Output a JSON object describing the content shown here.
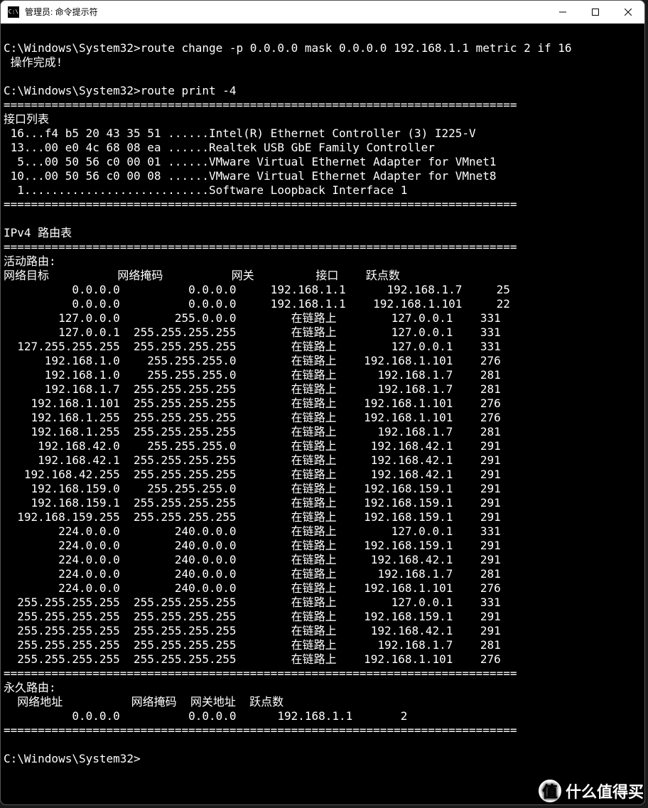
{
  "window": {
    "title": "管理员: 命令提示符",
    "icon_text": "C:\\"
  },
  "terminal": {
    "prompt": "C:\\Windows\\System32>",
    "cmd1": "route change -p 0.0.0.0 mask 0.0.0.0 192.168.1.1 metric 2 if 16",
    "cmd1_result": " 操作完成!",
    "cmd2": "route print -4",
    "divider": "===========================================================================",
    "interface_list_header": "接口列表",
    "interfaces": [
      " 16...f4 b5 20 43 35 51 ......Intel(R) Ethernet Controller (3) I225-V",
      " 13...00 e0 4c 68 08 ea ......Realtek USB GbE Family Controller",
      "  5...00 50 56 c0 00 01 ......VMware Virtual Ethernet Adapter for VMnet1",
      " 10...00 50 56 c0 00 08 ......VMware Virtual Ethernet Adapter for VMnet8",
      "  1...........................Software Loopback Interface 1"
    ],
    "ipv4_header": "IPv4 路由表",
    "active_routes_header": "活动路由:",
    "active_columns": [
      "网络目标",
      "网络掩码",
      "网关",
      "接口",
      "跃点数"
    ],
    "active_routes": [
      {
        "dest": "0.0.0.0",
        "mask": "0.0.0.0",
        "gateway": "192.168.1.1",
        "iface": "192.168.1.7",
        "metric": "25"
      },
      {
        "dest": "0.0.0.0",
        "mask": "0.0.0.0",
        "gateway": "192.168.1.1",
        "iface": "192.168.1.101",
        "metric": "22"
      },
      {
        "dest": "127.0.0.0",
        "mask": "255.0.0.0",
        "gateway": "在链路上",
        "iface": "127.0.0.1",
        "metric": "331"
      },
      {
        "dest": "127.0.0.1",
        "mask": "255.255.255.255",
        "gateway": "在链路上",
        "iface": "127.0.0.1",
        "metric": "331"
      },
      {
        "dest": "127.255.255.255",
        "mask": "255.255.255.255",
        "gateway": "在链路上",
        "iface": "127.0.0.1",
        "metric": "331"
      },
      {
        "dest": "192.168.1.0",
        "mask": "255.255.255.0",
        "gateway": "在链路上",
        "iface": "192.168.1.101",
        "metric": "276"
      },
      {
        "dest": "192.168.1.0",
        "mask": "255.255.255.0",
        "gateway": "在链路上",
        "iface": "192.168.1.7",
        "metric": "281"
      },
      {
        "dest": "192.168.1.7",
        "mask": "255.255.255.255",
        "gateway": "在链路上",
        "iface": "192.168.1.7",
        "metric": "281"
      },
      {
        "dest": "192.168.1.101",
        "mask": "255.255.255.255",
        "gateway": "在链路上",
        "iface": "192.168.1.101",
        "metric": "276"
      },
      {
        "dest": "192.168.1.255",
        "mask": "255.255.255.255",
        "gateway": "在链路上",
        "iface": "192.168.1.101",
        "metric": "276"
      },
      {
        "dest": "192.168.1.255",
        "mask": "255.255.255.255",
        "gateway": "在链路上",
        "iface": "192.168.1.7",
        "metric": "281"
      },
      {
        "dest": "192.168.42.0",
        "mask": "255.255.255.0",
        "gateway": "在链路上",
        "iface": "192.168.42.1",
        "metric": "291"
      },
      {
        "dest": "192.168.42.1",
        "mask": "255.255.255.255",
        "gateway": "在链路上",
        "iface": "192.168.42.1",
        "metric": "291"
      },
      {
        "dest": "192.168.42.255",
        "mask": "255.255.255.255",
        "gateway": "在链路上",
        "iface": "192.168.42.1",
        "metric": "291"
      },
      {
        "dest": "192.168.159.0",
        "mask": "255.255.255.0",
        "gateway": "在链路上",
        "iface": "192.168.159.1",
        "metric": "291"
      },
      {
        "dest": "192.168.159.1",
        "mask": "255.255.255.255",
        "gateway": "在链路上",
        "iface": "192.168.159.1",
        "metric": "291"
      },
      {
        "dest": "192.168.159.255",
        "mask": "255.255.255.255",
        "gateway": "在链路上",
        "iface": "192.168.159.1",
        "metric": "291"
      },
      {
        "dest": "224.0.0.0",
        "mask": "240.0.0.0",
        "gateway": "在链路上",
        "iface": "127.0.0.1",
        "metric": "331"
      },
      {
        "dest": "224.0.0.0",
        "mask": "240.0.0.0",
        "gateway": "在链路上",
        "iface": "192.168.159.1",
        "metric": "291"
      },
      {
        "dest": "224.0.0.0",
        "mask": "240.0.0.0",
        "gateway": "在链路上",
        "iface": "192.168.42.1",
        "metric": "291"
      },
      {
        "dest": "224.0.0.0",
        "mask": "240.0.0.0",
        "gateway": "在链路上",
        "iface": "192.168.1.7",
        "metric": "281"
      },
      {
        "dest": "224.0.0.0",
        "mask": "240.0.0.0",
        "gateway": "在链路上",
        "iface": "192.168.1.101",
        "metric": "276"
      },
      {
        "dest": "255.255.255.255",
        "mask": "255.255.255.255",
        "gateway": "在链路上",
        "iface": "127.0.0.1",
        "metric": "331"
      },
      {
        "dest": "255.255.255.255",
        "mask": "255.255.255.255",
        "gateway": "在链路上",
        "iface": "192.168.159.1",
        "metric": "291"
      },
      {
        "dest": "255.255.255.255",
        "mask": "255.255.255.255",
        "gateway": "在链路上",
        "iface": "192.168.42.1",
        "metric": "291"
      },
      {
        "dest": "255.255.255.255",
        "mask": "255.255.255.255",
        "gateway": "在链路上",
        "iface": "192.168.1.7",
        "metric": "281"
      },
      {
        "dest": "255.255.255.255",
        "mask": "255.255.255.255",
        "gateway": "在链路上",
        "iface": "192.168.1.101",
        "metric": "276"
      }
    ],
    "persistent_routes_header": "永久路由:",
    "persistent_columns": [
      "网络地址",
      "网络掩码",
      "网关地址",
      "跃点数"
    ],
    "persistent_routes": [
      {
        "dest": "0.0.0.0",
        "mask": "0.0.0.0",
        "gateway": "192.168.1.1",
        "metric": "2"
      }
    ]
  },
  "watermark": {
    "badge": "值",
    "text": "什么值得买"
  }
}
